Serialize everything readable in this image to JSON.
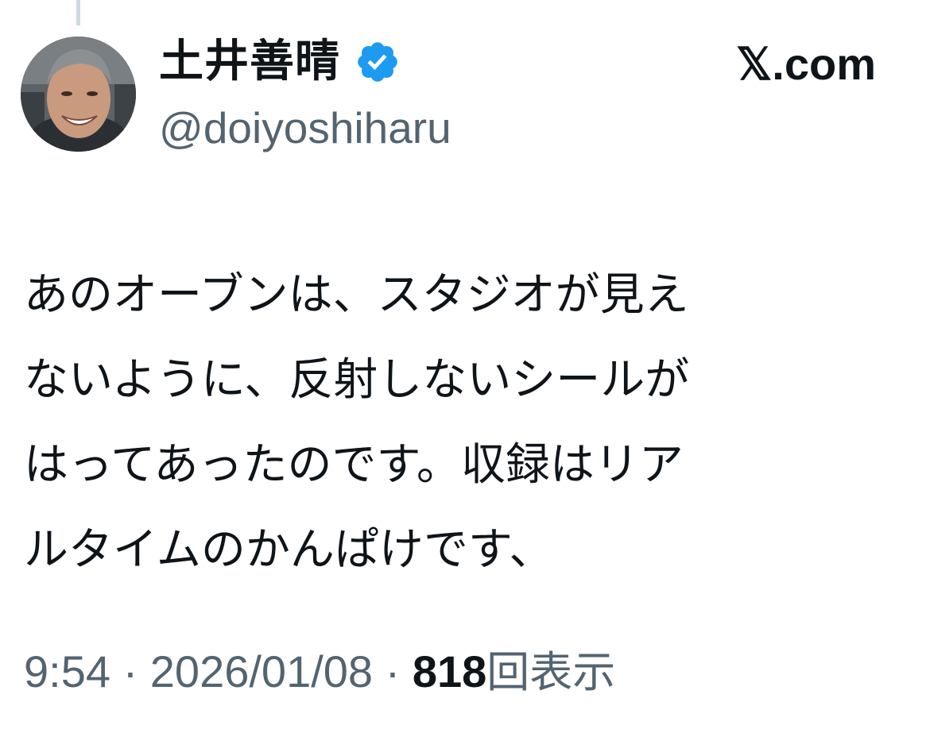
{
  "author": {
    "display_name": "土井善晴",
    "handle": "@doiyoshiharu",
    "verified": true,
    "verified_color": "#1d9bf0"
  },
  "brand": {
    "label": "𝕏.com",
    "icon": "x-logo"
  },
  "tweet": {
    "lines": [
      "あのオーブンは、スタジオが見え",
      "ないように、反射しないシールが",
      "はってあったのです。収録はリア",
      "ルタイムのかんぱけです、"
    ]
  },
  "meta": {
    "time": "9:54",
    "separator": "·",
    "date": "2026/01/08",
    "views_count": "818",
    "views_label": "回表示"
  },
  "colors": {
    "text_primary": "#0f1419",
    "text_secondary": "#536471",
    "thread_line": "#cfd9de"
  }
}
